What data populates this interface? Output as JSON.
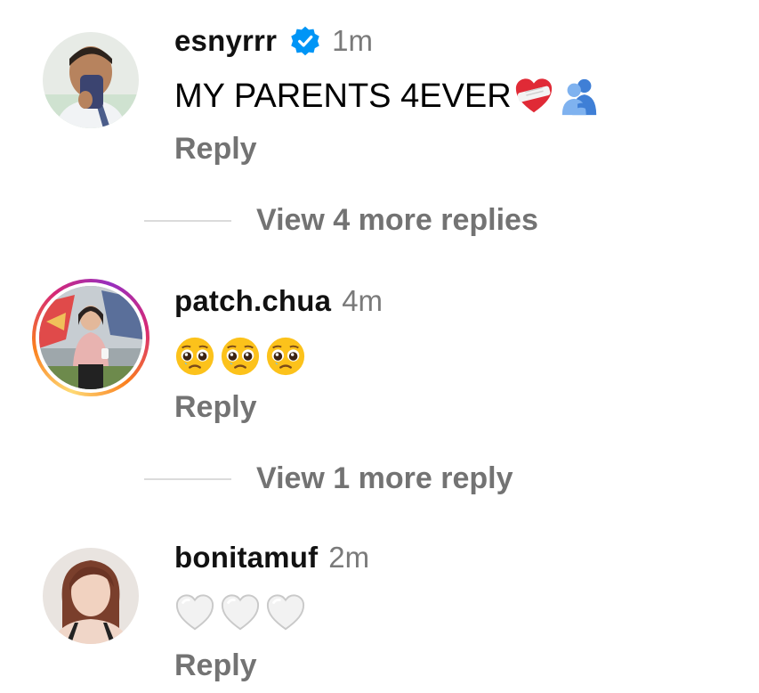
{
  "comments": [
    {
      "username": "esnyrrr",
      "verified": true,
      "time": "1m",
      "text": "MY PARENTS 4EVER",
      "emojis": [
        "mending-heart-icon",
        "people-hugging-icon"
      ],
      "reply_label": "Reply",
      "more_replies": "View 4 more replies"
    },
    {
      "username": "patch.chua",
      "verified": false,
      "time": "4m",
      "text": "",
      "emojis": [
        "pleading-face-icon",
        "pleading-face-icon",
        "pleading-face-icon"
      ],
      "reply_label": "Reply",
      "more_replies": "View 1 more reply"
    },
    {
      "username": "bonitamuf",
      "verified": false,
      "time": "2m",
      "text": "",
      "emojis": [
        "white-heart-icon",
        "white-heart-icon",
        "white-heart-icon"
      ],
      "reply_label": "Reply",
      "more_replies": ""
    }
  ],
  "colors": {
    "verified": "#0095f6",
    "secondary_text": "#737373",
    "divider": "#dbdbdb"
  }
}
